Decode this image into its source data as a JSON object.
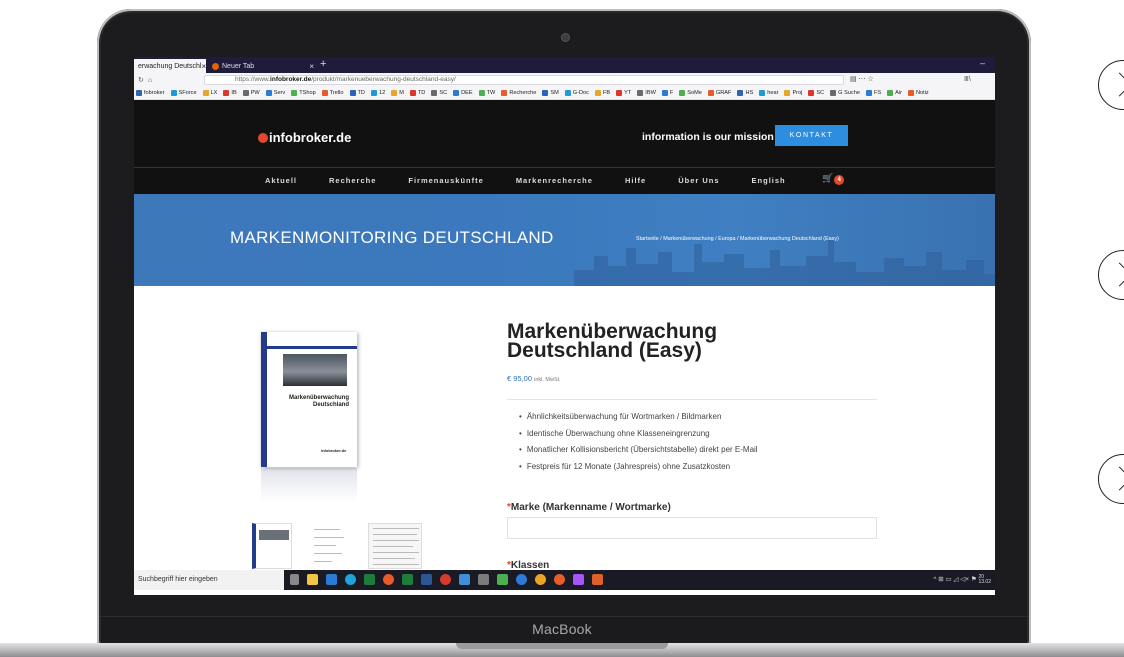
{
  "browser": {
    "active_tab": "erwachung Deutschl",
    "inactive_tab": "Neuer Tab",
    "url_prefix": "https://www.",
    "url_domain": "infobroker.de",
    "url_path": "/produkt/markenueberwachung-deutschland-easy/",
    "bookmarks": [
      "fobroker",
      "SForce",
      "LX",
      "IB",
      "PW",
      "Serv",
      "TShop",
      "Trello",
      "TD",
      "12",
      "M",
      "TD",
      "SC",
      "DEE",
      "TW",
      "Recherche",
      "SM",
      "G-Doc",
      "FB",
      "YT",
      "IBW",
      "F",
      "SoMe",
      "GRAF",
      "HS",
      "hear",
      "Proj",
      "SC",
      "G Suche",
      "FS",
      "Air",
      "Notiz"
    ]
  },
  "site": {
    "logo": "infobroker.de",
    "mission": "information is our mission",
    "kontakt": "KONTAKT",
    "menu": [
      "Aktuell",
      "Recherche",
      "Firmenauskünfte",
      "Markenrecherche",
      "Hilfe",
      "Über Uns",
      "English"
    ],
    "cart_count": "4",
    "banner_title": "MARKENMONITORING DEUTSCHLAND",
    "breadcrumb": "Startseite / Markenüberwachung / Europa / Markenüberwachung Deutschland (Easy)"
  },
  "product": {
    "title_line1": "Markenüberwachung",
    "title_line2": "Deutschland (Easy)",
    "price": "€ 95,00",
    "price_note": "inkl. MwSt.",
    "features": [
      "Ähnlichkeitsüberwachung für Wortmarken / Bildmarken",
      "Identische Überwachung ohne Klasseneingrenzung",
      "Monatlicher Kollisionsbericht (Übersichtstabelle) direkt per E-Mail",
      "Festpreis für 12 Monate (Jahrespreis) ohne Zusatzkosten"
    ],
    "field_label": "Marke (Markenname / Wortmarke)",
    "field2_label": "Klassen",
    "required_mark": "*",
    "book_title": "Markenüberwachung Deutschland",
    "book_brand": "infobroker.de"
  },
  "taskbar": {
    "search_placeholder": "Suchbegriff hier eingeben",
    "clock_time": "20",
    "clock_date": "13.02"
  },
  "device": {
    "label": "MacBook"
  }
}
